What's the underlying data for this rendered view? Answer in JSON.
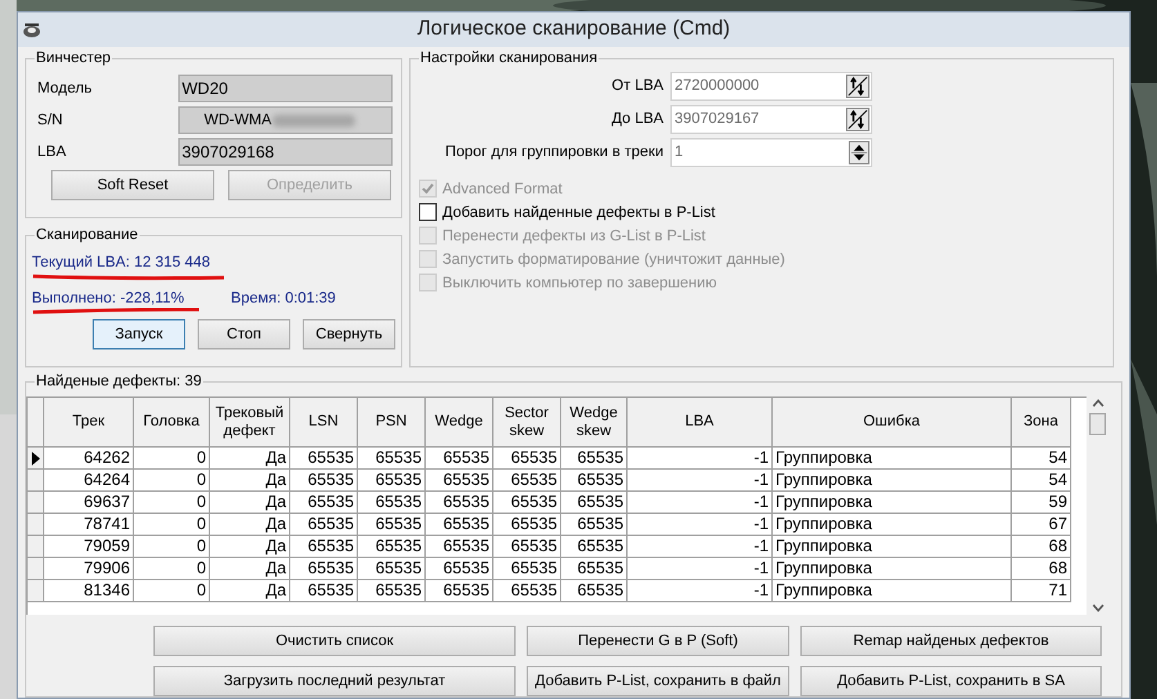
{
  "window": {
    "title": "Логическое сканирование (Cmd)"
  },
  "drive": {
    "title": "Винчестер",
    "fields": [
      {
        "label": "Модель",
        "value": "WD20"
      },
      {
        "label": "S/N",
        "value": "WD-WMA",
        "blurred": true
      },
      {
        "label": "LBA",
        "value": "3907029168"
      }
    ],
    "buttons": [
      {
        "label": "Soft Reset",
        "disabled": false
      },
      {
        "label": "Определить",
        "disabled": true
      }
    ]
  },
  "scan": {
    "title": "Сканирование",
    "current_lba": "Текущий LBA: 12 315 448",
    "done": "Выполнено: -228,11%",
    "time": "Время: 0:01:39",
    "buttons": [
      {
        "label": "Запуск",
        "focused": true
      },
      {
        "label": "Стоп",
        "focused": false
      },
      {
        "label": "Свернуть",
        "focused": false
      }
    ]
  },
  "settings": {
    "title": "Настройки сканирования",
    "fields": [
      {
        "label": "От LBA",
        "value": "2720000000",
        "kind": "swap"
      },
      {
        "label": "До LBA",
        "value": "3907029167",
        "kind": "swap"
      },
      {
        "label": "Порог для группировки в треки",
        "value": "1",
        "kind": "spin"
      }
    ],
    "options": [
      {
        "label": "Advanced Format",
        "checked": true,
        "disabled": true
      },
      {
        "label": "Добавить найденные дефекты в P-List",
        "checked": false,
        "disabled": false
      },
      {
        "label": "Перенести дефекты из G-List в P-List",
        "checked": false,
        "disabled": true
      },
      {
        "label": "Запустить форматирование (уничтожит данные)",
        "checked": false,
        "disabled": true
      },
      {
        "label": "Выключить компьютер по завершению",
        "checked": false,
        "disabled": true
      }
    ]
  },
  "defects": {
    "title": "Найденые дефекты: 39",
    "columns": [
      "Трек",
      "Головка",
      "Трековый дефект",
      "LSN",
      "PSN",
      "Wedge",
      "Sector skew",
      "Wedge skew",
      "LBA",
      "Ошибка",
      "Зона"
    ],
    "rows": [
      {
        "selected": true,
        "cells": [
          "64262",
          "0",
          "Да",
          "65535",
          "65535",
          "65535",
          "65535",
          "65535",
          "-1",
          "Группировка",
          "54"
        ]
      },
      {
        "selected": false,
        "cells": [
          "64264",
          "0",
          "Да",
          "65535",
          "65535",
          "65535",
          "65535",
          "65535",
          "-1",
          "Группировка",
          "54"
        ]
      },
      {
        "selected": false,
        "cells": [
          "69637",
          "0",
          "Да",
          "65535",
          "65535",
          "65535",
          "65535",
          "65535",
          "-1",
          "Группировка",
          "59"
        ]
      },
      {
        "selected": false,
        "cells": [
          "78741",
          "0",
          "Да",
          "65535",
          "65535",
          "65535",
          "65535",
          "65535",
          "-1",
          "Группировка",
          "67"
        ]
      },
      {
        "selected": false,
        "cells": [
          "79059",
          "0",
          "Да",
          "65535",
          "65535",
          "65535",
          "65535",
          "65535",
          "-1",
          "Группировка",
          "68"
        ]
      },
      {
        "selected": false,
        "cells": [
          "79906",
          "0",
          "Да",
          "65535",
          "65535",
          "65535",
          "65535",
          "65535",
          "-1",
          "Группировка",
          "68"
        ]
      },
      {
        "selected": false,
        "cells": [
          "81346",
          "0",
          "Да",
          "65535",
          "65535",
          "65535",
          "65535",
          "65535",
          "-1",
          "Группировка",
          "71"
        ]
      }
    ],
    "buttons": [
      "Очистить список",
      "Перенести G в P (Soft)",
      "Remap найденых дефектов",
      "Загрузить последний результат",
      "Добавить P-List, сохранить в файл",
      "Добавить P-List, сохранить в SA"
    ]
  }
}
